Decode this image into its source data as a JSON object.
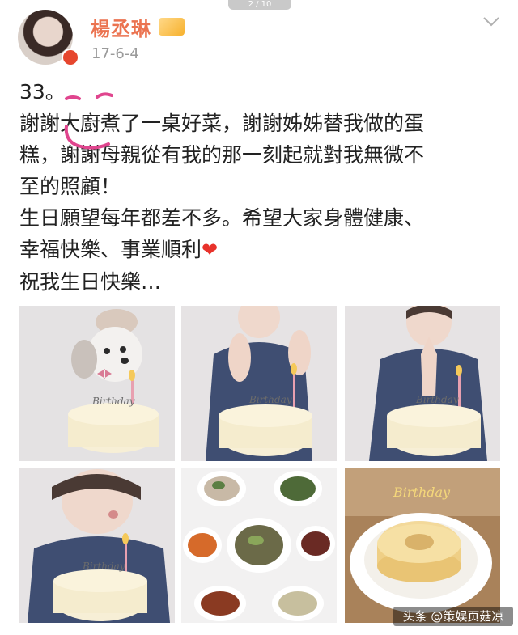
{
  "header": {
    "page_indicator": "2 / 10",
    "username": "楊丞琳",
    "date": "17-6-4"
  },
  "post": {
    "lines": [
      "33。",
      "謝謝大廚煮了一桌好菜，謝謝姊姊替我做的蛋",
      "糕，謝謝母親從有我的那一刻起就對我無微不",
      "至的照顧！",
      "生日願望每年都差不多。希望大家身體健康、",
      "幸福快樂、事業順利",
      "祝我生日快樂…"
    ],
    "heart_icon": "heart-emoji"
  },
  "photos": [
    {
      "name": "photo-cake-with-dog",
      "icon": "cake-dog-photo"
    },
    {
      "name": "photo-clapping",
      "icon": "clapping-photo"
    },
    {
      "name": "photo-wishing",
      "icon": "wishing-photo"
    },
    {
      "name": "photo-blowing-candle",
      "icon": "blowing-candle-photo"
    },
    {
      "name": "photo-dishes",
      "icon": "dishes-photo"
    },
    {
      "name": "photo-bundt-cake",
      "icon": "bundt-cake-photo"
    }
  ],
  "watermark": "头条 @策娱页菇凉",
  "colors": {
    "username": "#eb7350",
    "scribble": "#e0458e",
    "heart": "#e8322b"
  }
}
